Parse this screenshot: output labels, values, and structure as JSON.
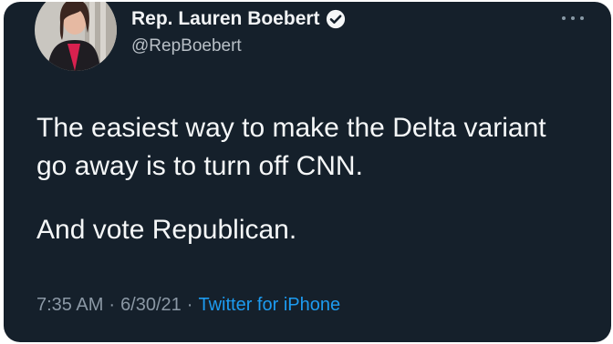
{
  "author": {
    "display_name": "Rep. Lauren Boebert",
    "handle": "@RepBoebert",
    "verified": true
  },
  "tweet": {
    "paragraphs": [
      "The easiest way to make the Delta variant go away is to turn off CNN.",
      "And vote Republican."
    ],
    "time": "7:35 AM",
    "date": "6/30/21",
    "separator": "·",
    "source": "Twitter for iPhone"
  },
  "icons": {
    "verified": "verified-badge-icon",
    "more": "more-options-icon"
  },
  "colors": {
    "background": "#15202b",
    "text": "#f5f7f8",
    "secondary": "#8b98a5",
    "link": "#1d9bf0"
  }
}
